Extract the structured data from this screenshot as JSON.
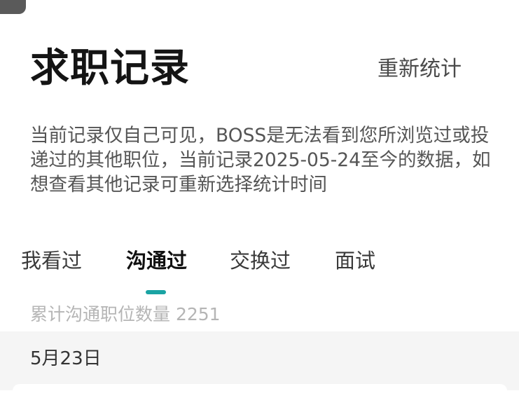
{
  "header": {
    "title": "求职记录",
    "recount_label": "重新统计"
  },
  "notice": {
    "text": "当前记录仅自己可见，BOSS是无法看到您所浏览过或投递过的其他职位，当前记录2025-05-24至今的数据，如想查看其他记录可重新选择统计时间"
  },
  "tabs": [
    {
      "label": "我看过",
      "active": false
    },
    {
      "label": "沟通过",
      "active": true
    },
    {
      "label": "交换过",
      "active": false
    },
    {
      "label": "面试",
      "active": false
    }
  ],
  "summary": {
    "label": "累计沟通职位数量 2251"
  },
  "list": {
    "date": "5月23日"
  },
  "colors": {
    "accent": "#1aa3a3",
    "background": "#ffffff",
    "band": "#f5f5f5"
  }
}
